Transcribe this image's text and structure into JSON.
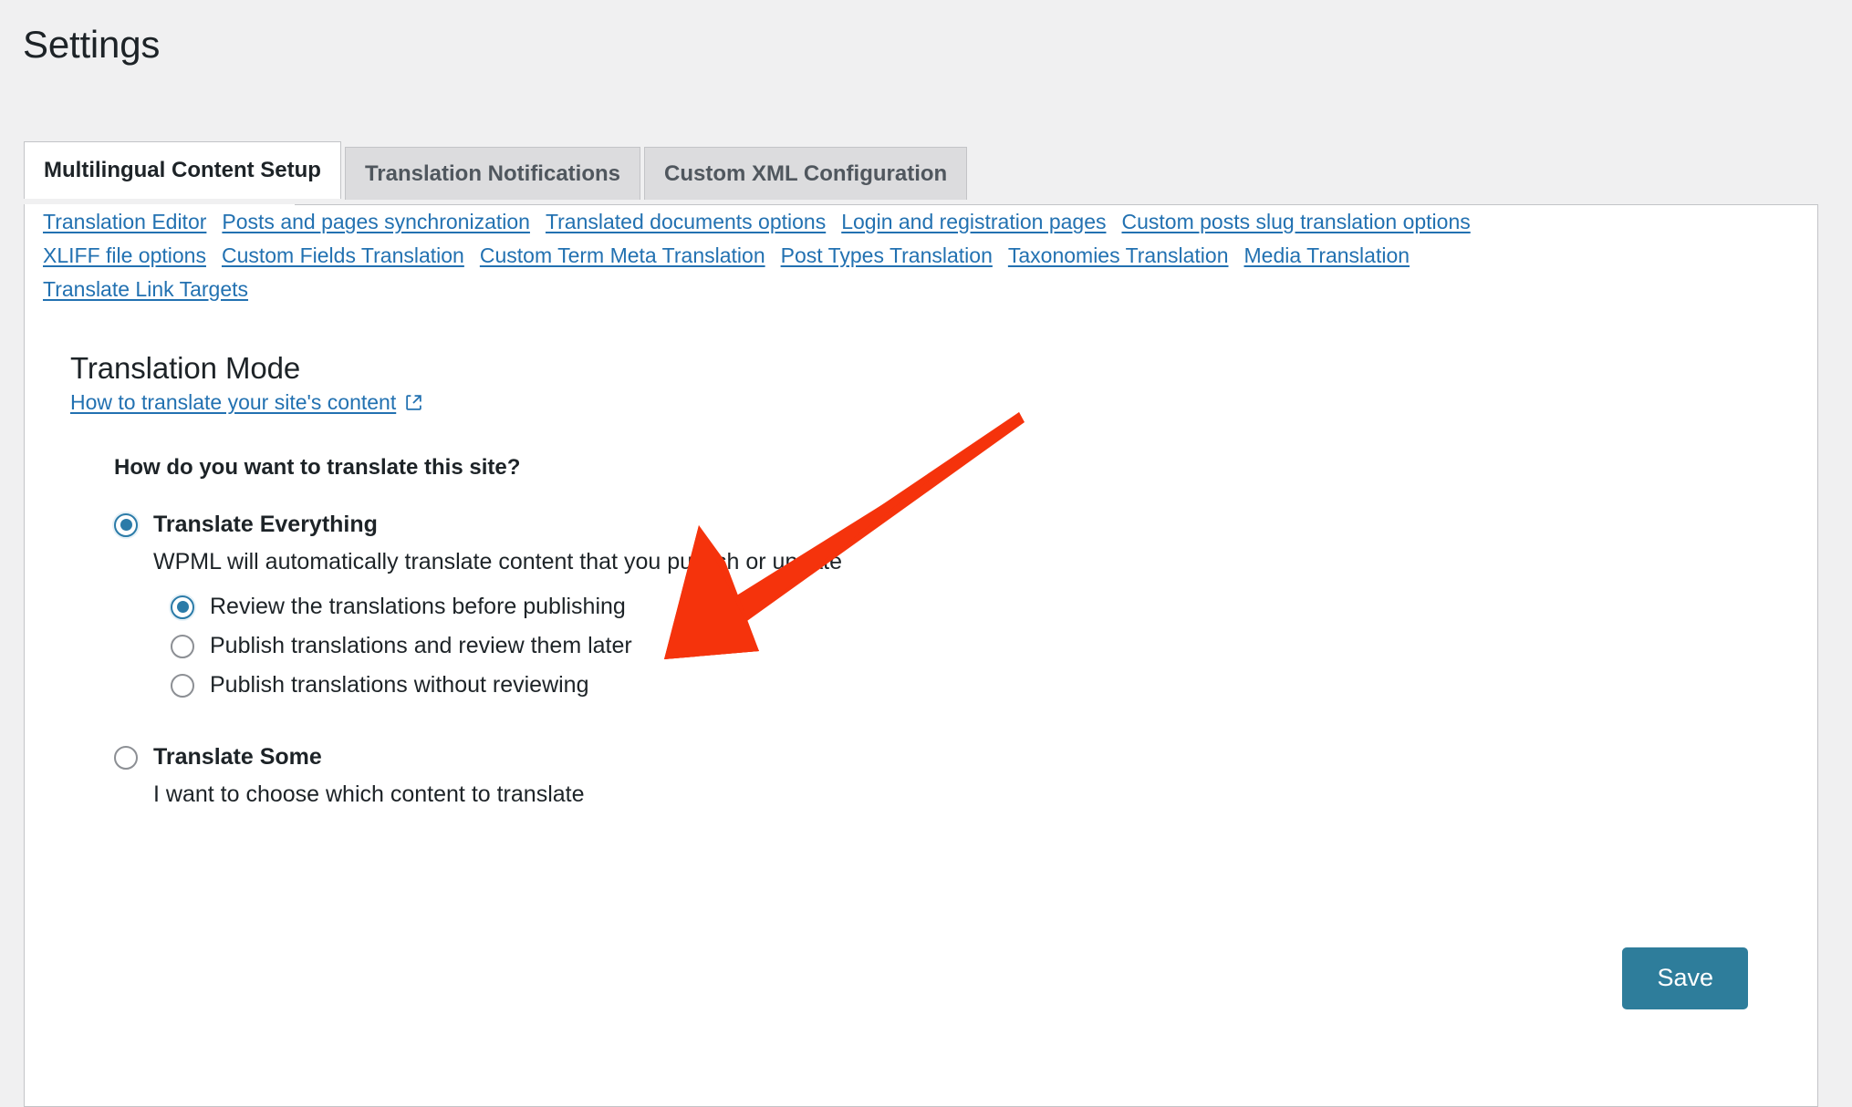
{
  "page": {
    "title": "Settings",
    "background_color": "#f0f0f1",
    "accent_color": "#2271b1",
    "save_color": "#2e7d9b",
    "arrow_color": "#f5330c"
  },
  "tabs": [
    {
      "label": "Multilingual Content Setup",
      "active": true
    },
    {
      "label": "Translation Notifications",
      "active": false
    },
    {
      "label": "Custom XML Configuration",
      "active": false
    }
  ],
  "quicklinks": [
    {
      "label": "Translation Editor"
    },
    {
      "label": "Posts and pages synchronization"
    },
    {
      "label": "Translated documents options"
    },
    {
      "label": "Login and registration pages"
    },
    {
      "label": "Custom posts slug translation options"
    },
    {
      "label": "XLIFF file options"
    },
    {
      "label": "Custom Fields Translation"
    },
    {
      "label": "Custom Term Meta Translation"
    },
    {
      "label": "Post Types Translation"
    },
    {
      "label": "Taxonomies Translation"
    },
    {
      "label": "Media Translation"
    },
    {
      "label": "Translate Link Targets"
    }
  ],
  "translation_mode": {
    "heading": "Translation Mode",
    "help_link": "How to translate your site's content",
    "help_link_icon": "external-link-icon",
    "question": "How do you want to translate this site?",
    "options": [
      {
        "label": "Translate Everything",
        "description": "WPML will automatically translate content that you publish or update",
        "selected": true,
        "suboptions": [
          {
            "label": "Review the translations before publishing",
            "selected": true
          },
          {
            "label": "Publish translations and review them later",
            "selected": false
          },
          {
            "label": "Publish translations without reviewing",
            "selected": false
          }
        ]
      },
      {
        "label": "Translate Some",
        "description": "I want to choose which content to translate",
        "selected": false,
        "suboptions": []
      }
    ]
  },
  "actions": {
    "save_label": "Save"
  },
  "annotation": {
    "type": "arrow",
    "points_to": "Translate Everything",
    "color": "#f5330c"
  }
}
